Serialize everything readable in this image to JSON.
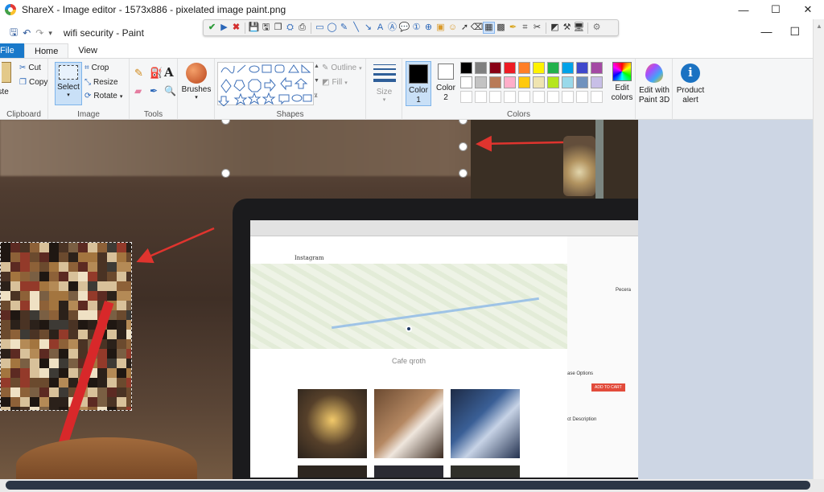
{
  "window": {
    "title": "ShareX - Image editor - 1573x886 - pixelated image paint.png",
    "minimize": "—",
    "maximize": "☐",
    "close": "✕"
  },
  "sharex_toolbar": {
    "icons": [
      "confirm-check-icon",
      "run-arrow-icon",
      "cancel-x-icon",
      "save-icon",
      "save-as-icon",
      "copy-icon",
      "upload-icon",
      "print-icon",
      "rectangle-icon",
      "ellipse-icon",
      "freehand-icon",
      "line-icon",
      "arrow-icon",
      "text-outline-icon",
      "text-background-icon",
      "speech-balloon-icon",
      "step-icon",
      "magnify-icon",
      "image-icon",
      "sticker-icon",
      "cursor-icon",
      "smart-eraser-icon",
      "blur-icon",
      "pixelate-icon",
      "highlight-icon",
      "crop-icon",
      "cut-out-icon",
      "fill-icon",
      "tools-menu-icon",
      "screen-icon",
      "settings-icon"
    ]
  },
  "paint": {
    "doc_title": "wifi security - Paint",
    "tabs": {
      "file": "File",
      "home": "Home",
      "view": "View"
    },
    "clipboard": {
      "paste": "Paste",
      "cut": "Cut",
      "copy": "Copy",
      "label": "Clipboard"
    },
    "image": {
      "select": "Select",
      "crop": "Crop",
      "resize": "Resize",
      "rotate": "Rotate",
      "label": "Image"
    },
    "tools": {
      "label": "Tools"
    },
    "brushes": {
      "label": "Brushes"
    },
    "shapes": {
      "outline": "Outline",
      "fill": "Fill",
      "label": "Shapes"
    },
    "size": {
      "label": "Size"
    },
    "colors": {
      "color1": "Color",
      "color1_num": "1",
      "color2": "Color",
      "color2_num": "2",
      "edit": "Edit colors",
      "label": "Colors",
      "palette_row1": [
        "#000000",
        "#7f7f7f",
        "#880015",
        "#ed1c24",
        "#ff7f27",
        "#fff200",
        "#22b14c",
        "#00a2e8",
        "#3f48cc",
        "#a349a4"
      ],
      "palette_row2": [
        "#ffffff",
        "#c3c3c3",
        "#b97a57",
        "#ffaec9",
        "#ffc90e",
        "#efe4b0",
        "#b5e61d",
        "#99d9ea",
        "#7092be",
        "#c8bfe7"
      ]
    },
    "paint3d": "Edit with Paint 3D",
    "product_alert": "Product alert"
  },
  "canvas": {
    "cafe_title": "Cafe qroth",
    "ig_logo": "Instagram",
    "side_name": "Pecera",
    "add_to_cart": "ADD TO CART",
    "purchase_options": "ase Options",
    "product_description": "ct Description"
  }
}
